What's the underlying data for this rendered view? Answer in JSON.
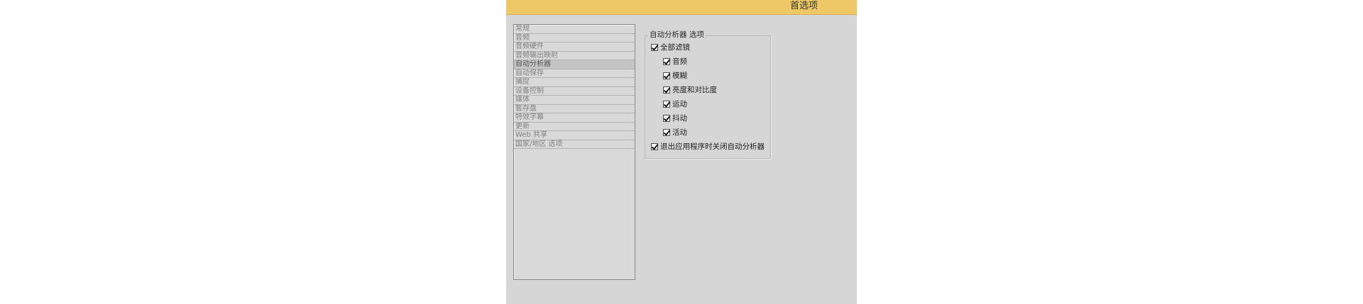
{
  "window": {
    "title": "首选项"
  },
  "categories": [
    {
      "label": "常规",
      "selected": false
    },
    {
      "label": "音频",
      "selected": false
    },
    {
      "label": "音频硬件",
      "selected": false
    },
    {
      "label": "音频输出映射",
      "selected": false
    },
    {
      "label": "自动分析器",
      "selected": true
    },
    {
      "label": "自动保存",
      "selected": false
    },
    {
      "label": "捕捉",
      "selected": false
    },
    {
      "label": "设备控制",
      "selected": false
    },
    {
      "label": "媒体",
      "selected": false
    },
    {
      "label": "暂存盘",
      "selected": false
    },
    {
      "label": "特效字幕",
      "selected": false
    },
    {
      "label": "更新",
      "selected": false
    },
    {
      "label": "Web 共享",
      "selected": false
    },
    {
      "label": "国家/地区 选项",
      "selected": false
    }
  ],
  "options_group": {
    "title": "自动分析器 选项",
    "all_filters": {
      "label": "全部滤镜",
      "checked": true
    },
    "filters": [
      {
        "label": "音频",
        "checked": true
      },
      {
        "label": "模糊",
        "checked": true
      },
      {
        "label": "亮度和对比度",
        "checked": true
      },
      {
        "label": "运动",
        "checked": true
      },
      {
        "label": "抖动",
        "checked": true
      },
      {
        "label": "活动",
        "checked": true
      }
    ],
    "close_on_exit": {
      "label": "退出应用程序时关闭自动分析器",
      "checked": true
    }
  },
  "colors": {
    "titlebar": "#eec766",
    "dialog_background": "#d6d6d6",
    "selected_item": "#c4c4c4"
  }
}
